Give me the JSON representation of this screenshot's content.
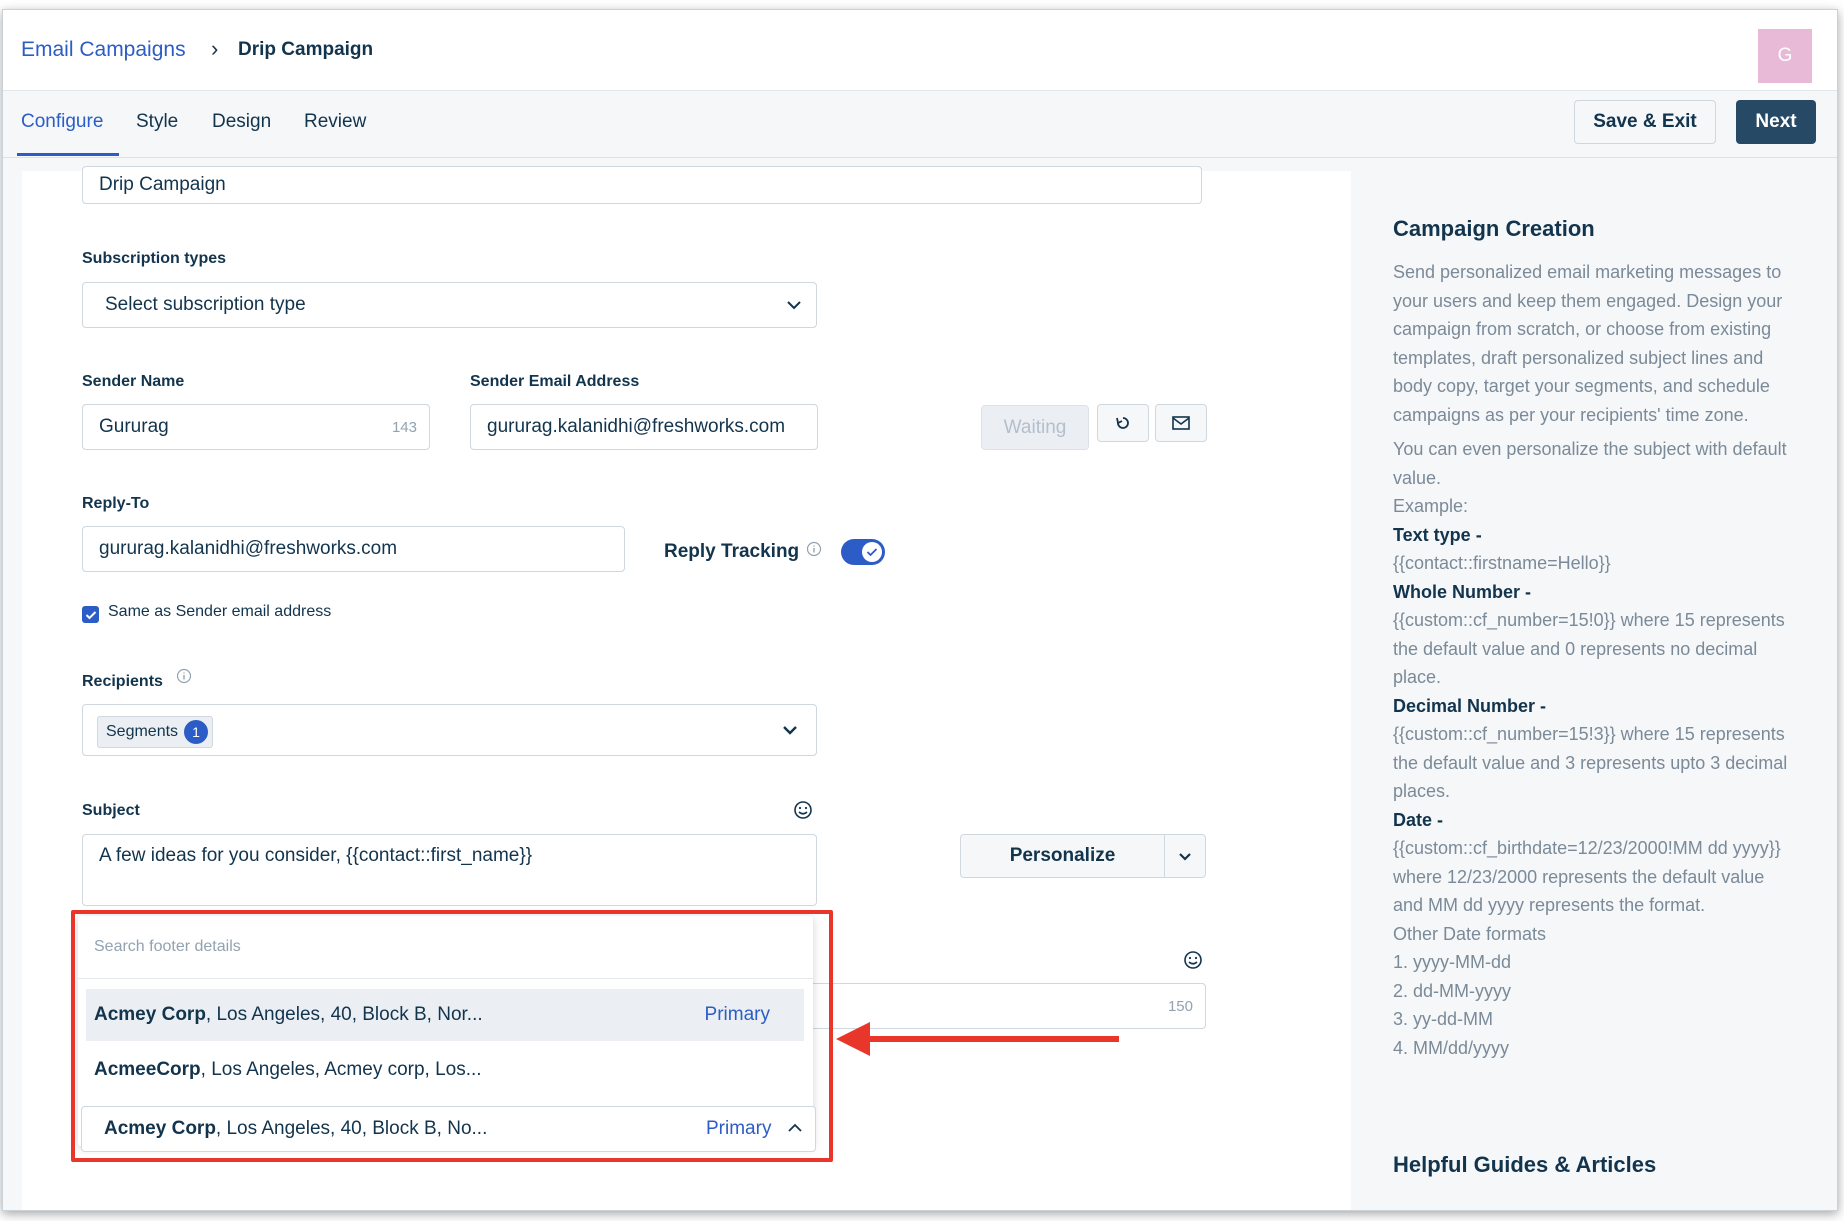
{
  "breadcrumb": {
    "parent": "Email Campaigns",
    "separator": "›",
    "current": "Drip Campaign"
  },
  "avatar": {
    "initial": "G",
    "color": "#e9b9d8"
  },
  "tabs": [
    {
      "label": "Configure",
      "active": true
    },
    {
      "label": "Style",
      "active": false
    },
    {
      "label": "Design",
      "active": false
    },
    {
      "label": "Review",
      "active": false
    }
  ],
  "actions": {
    "save_exit": "Save & Exit",
    "next": "Next"
  },
  "form": {
    "campaign_name": "Drip Campaign",
    "subscription": {
      "label": "Subscription types",
      "placeholder": "Select subscription type"
    },
    "sender_name": {
      "label": "Sender Name",
      "value": "Gururag",
      "count": "143"
    },
    "sender_email": {
      "label": "Sender Email Address",
      "value": "gururag.kalanidhi@freshworks.com",
      "status": "Waiting"
    },
    "reply_to": {
      "label": "Reply-To",
      "value": "gururag.kalanidhi@freshworks.com"
    },
    "reply_tracking": {
      "label": "Reply Tracking",
      "enabled": true
    },
    "same_as_sender": {
      "label": "Same as Sender email address",
      "checked": true
    },
    "recipients": {
      "label": "Recipients",
      "chip": "Segments",
      "count": "1"
    },
    "subject": {
      "label": "Subject",
      "value": "A few ideas for you consider,  {{contact::first_name}}"
    },
    "personalize": {
      "label": "Personalize"
    },
    "preheader_count": "150"
  },
  "footer_dropdown": {
    "search_placeholder": "Search footer details",
    "options": [
      {
        "name": "Acmey Corp",
        "rest": ", Los Angeles, 40, Block B, Nor...",
        "tag": "Primary",
        "highlighted": true
      },
      {
        "name": "AcmeeCorp",
        "rest": ", Los Angeles, Acmey corp, Los...",
        "tag": "",
        "highlighted": false
      }
    ],
    "selected": {
      "name": "Acmey Corp",
      "rest": ", Los Angeles, 40, Block B, No...",
      "tag": "Primary"
    }
  },
  "side_panel": {
    "title": "Campaign Creation",
    "intro": "Send personalized email marketing messages to your users and keep them engaged. Design your campaign from scratch, or choose from existing templates, draft personalized subject lines and body copy, target your segments, and schedule campaigns as per your recipients' time zone.",
    "para2": "You can even personalize the subject with default value.",
    "example_label": "Example:",
    "text_type_heading": "Text type -",
    "text_type_example": "{{contact::firstname=Hello}}",
    "whole_heading": "Whole Number -",
    "whole_example": "{{custom::cf_number=15!0}} where 15 represents the default value and 0 represents no decimal place.",
    "decimal_heading": "Decimal Number -",
    "decimal_example": "{{custom::cf_number=15!3}} where 15 represents the default value and 3 represents upto 3 decimal places.",
    "date_heading": "Date -",
    "date_example": "{{custom::cf_birthdate=12/23/2000!MM dd yyyy}} where 12/23/2000 represents the default value and MM dd yyyy represents the format.",
    "other_formats_label": "Other Date formats",
    "formats": [
      "1. yyyy-MM-dd",
      "2. dd-MM-yyyy",
      "3. yy-dd-MM",
      "4. MM/dd/yyyy"
    ],
    "guides_heading": "Helpful Guides & Articles"
  },
  "colors": {
    "accent": "#2c5cc5",
    "primary_button": "#264966",
    "annotation": "#e8372a"
  }
}
